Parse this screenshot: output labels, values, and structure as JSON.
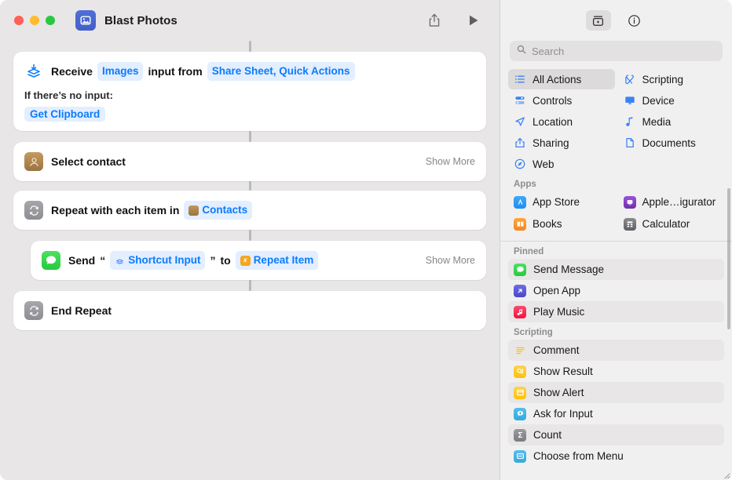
{
  "window": {
    "title": "Blast Photos",
    "app_icon": "photos-icon",
    "traffic_lights": [
      "close",
      "minimize",
      "maximize"
    ],
    "toolbar": {
      "share_label": "share-icon",
      "run_label": "play-icon"
    }
  },
  "editor": {
    "actions": [
      {
        "id": "receive",
        "icon": "receive-input-icon",
        "prefix": "Receive",
        "token_type": "Images",
        "middle": "input from",
        "token_source": "Share Sheet, Quick Actions",
        "no_input_label": "If there’s no input:",
        "no_input_action": "Get Clipboard"
      },
      {
        "id": "select-contact",
        "icon": "contacts-icon",
        "title": "Select contact",
        "show_more": "Show More"
      },
      {
        "id": "repeat-each",
        "icon": "repeat-icon",
        "prefix": "Repeat with each item in",
        "token": "Contacts",
        "token_icon": "contacts-icon"
      },
      {
        "id": "send-message",
        "icon": "messages-icon",
        "prefix": "Send",
        "quote_open": "“",
        "token_input": "Shortcut Input",
        "token_input_icon": "shortcut-input-icon",
        "quote_close": "”",
        "connector": "to",
        "token_target": "Repeat Item",
        "token_target_icon": "variable-icon",
        "show_more": "Show More"
      },
      {
        "id": "end-repeat",
        "icon": "repeat-icon",
        "title": "End Repeat"
      }
    ]
  },
  "sidebar": {
    "toolbar": {
      "library_button": "action-library-icon",
      "info_button": "info-icon"
    },
    "search": {
      "placeholder": "Search",
      "value": "",
      "icon": "search-icon"
    },
    "categories": [
      {
        "label": "All Actions",
        "icon": "list-icon",
        "selected": true
      },
      {
        "label": "Scripting",
        "icon": "scripting-icon",
        "selected": false
      },
      {
        "label": "Controls",
        "icon": "controls-icon",
        "selected": false
      },
      {
        "label": "Device",
        "icon": "device-icon",
        "selected": false
      },
      {
        "label": "Location",
        "icon": "location-icon",
        "selected": false
      },
      {
        "label": "Media",
        "icon": "media-icon",
        "selected": false
      },
      {
        "label": "Sharing",
        "icon": "sharing-icon",
        "selected": false
      },
      {
        "label": "Documents",
        "icon": "documents-icon",
        "selected": false
      },
      {
        "label": "Web",
        "icon": "web-icon",
        "selected": false
      }
    ],
    "apps": {
      "header": "Apps",
      "items": [
        {
          "label": "App Store",
          "icon": "app-store-icon",
          "color": "#1f8df5"
        },
        {
          "label": "Apple…igurator",
          "icon": "apple-configurator-icon",
          "color": "#7b3fb5"
        },
        {
          "label": "Books",
          "icon": "books-icon",
          "color": "#f6921e"
        },
        {
          "label": "Calculator",
          "icon": "calculator-icon",
          "color": "#6b6b70"
        }
      ]
    },
    "pinned": {
      "header": "Pinned",
      "items": [
        {
          "label": "Send Message",
          "icon": "messages-icon",
          "color": "#32d74b"
        },
        {
          "label": "Open App",
          "icon": "open-app-icon",
          "color": "#5856d6"
        },
        {
          "label": "Play Music",
          "icon": "music-icon",
          "color": "#fa2d55"
        }
      ]
    },
    "scripting": {
      "header": "Scripting",
      "items": [
        {
          "label": "Comment",
          "icon": "comment-icon",
          "color": "#ffc107"
        },
        {
          "label": "Show Result",
          "icon": "show-result-icon",
          "color": "#ffc107"
        },
        {
          "label": "Show Alert",
          "icon": "show-alert-icon",
          "color": "#ffc107"
        },
        {
          "label": "Ask for Input",
          "icon": "ask-for-input-icon",
          "color": "#34aadc"
        },
        {
          "label": "Count",
          "icon": "count-icon",
          "color": "#8e8e93"
        },
        {
          "label": "Choose from Menu",
          "icon": "choose-from-menu-icon",
          "color": "#34aadc"
        }
      ]
    }
  },
  "colors": {
    "accent_blue": "#0a7cff",
    "token_bg": "#e3eeff",
    "canvas_bg": "#e8e6e6",
    "sidebar_bg": "#f1f0f0"
  }
}
